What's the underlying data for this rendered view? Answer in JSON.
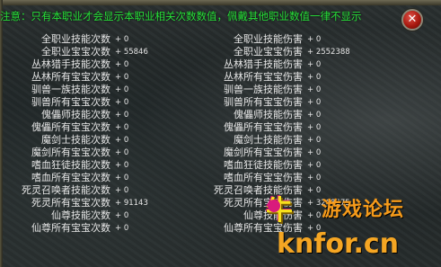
{
  "notice": "注意：只有本职业才会显示本职业相关次数数值，佩戴其他职业数值一律不显示",
  "rows": [
    {
      "left_label": "全职业技能次数",
      "left_value": "+ 0",
      "right_label": "全职业技能伤害",
      "right_value": "+ 0"
    },
    {
      "left_label": "全职业宝宝次数",
      "left_value": "+ 55846",
      "right_label": "全职业宝宝伤害",
      "right_value": "+ 2552388"
    },
    {
      "left_label": "丛林猎手技能次数",
      "left_value": "+ 0",
      "right_label": "丛林猎手技能伤害",
      "right_value": "+ 0"
    },
    {
      "left_label": "丛林所有宝宝次数",
      "left_value": "+ 0",
      "right_label": "丛林所有宝宝伤害",
      "right_value": "+ 0"
    },
    {
      "left_label": "驯兽一族技能次数",
      "left_value": "+ 0",
      "right_label": "驯兽一族技能伤害",
      "right_value": "+ 0"
    },
    {
      "left_label": "驯兽所有宝宝次数",
      "left_value": "+ 0",
      "right_label": "驯兽所有宝宝伤害",
      "right_value": "+ 0"
    },
    {
      "left_label": "傀儡师技能次数",
      "left_value": "+ 0",
      "right_label": "傀儡师技能伤害",
      "right_value": "+ 0"
    },
    {
      "left_label": "傀儡所有宝宝次数",
      "left_value": "+ 0",
      "right_label": "傀儡所有宝宝伤害",
      "right_value": "+ 0"
    },
    {
      "left_label": "魔剑士技能次数",
      "left_value": "+ 0",
      "right_label": "魔剑士技能伤害",
      "right_value": "+ 0"
    },
    {
      "left_label": "魔剑所有宝宝次数",
      "left_value": "+ 0",
      "right_label": "魔剑所有宝宝伤害",
      "right_value": "+ 0"
    },
    {
      "left_label": "嗜血狂徒技能次数",
      "left_value": "+ 0",
      "right_label": "嗜血狂徒技能伤害",
      "right_value": "+ 0"
    },
    {
      "left_label": "嗜血所有宝宝次数",
      "left_value": "+ 0",
      "right_label": "嗜血所有宝宝伤害",
      "right_value": "+ 0"
    },
    {
      "left_label": "死灵召唤者技能次数",
      "left_value": "+ 0",
      "right_label": "死灵召唤者技能伤害",
      "right_value": "+ 0"
    },
    {
      "left_label": "死灵所有宝宝次数",
      "left_value": "+ 91143",
      "right_label": "死灵所有宝宝伤害",
      "right_value": "+ 3268675"
    },
    {
      "left_label": "仙尊技能次数",
      "left_value": "+ 0",
      "right_label": "仙尊技能伤害",
      "right_value": "+ 0"
    },
    {
      "left_label": "仙尊所有宝宝次数",
      "left_value": "+ 0",
      "right_label": "仙尊所有宝宝伤害",
      "right_value": "+ 0"
    }
  ],
  "close_glyph": "✕",
  "watermark": {
    "logo_glyph": "牛",
    "title": "游戏论坛",
    "site": "knfor.cn"
  }
}
